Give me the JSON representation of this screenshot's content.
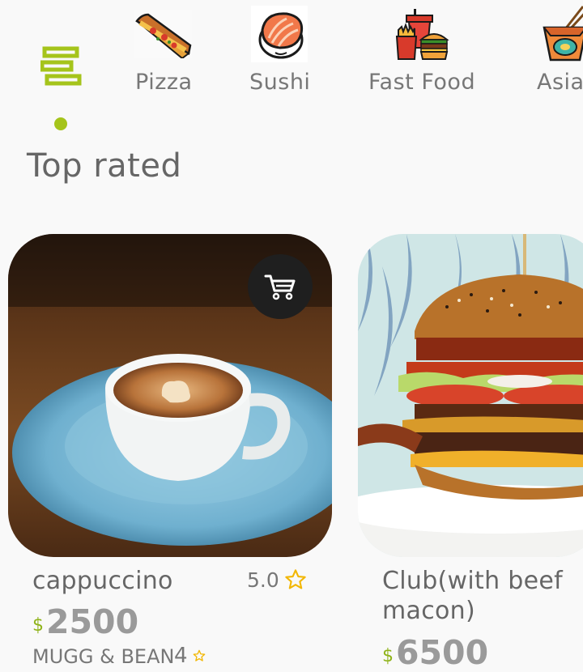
{
  "categories": [
    {
      "label": "Pizza",
      "icon": "pizza-icon"
    },
    {
      "label": "Sushi",
      "icon": "sushi-icon"
    },
    {
      "label": "Fast Food",
      "icon": "fast-food-icon"
    },
    {
      "label": "Asia",
      "icon": "asian-food-icon"
    }
  ],
  "colors": {
    "accent": "#a5c41b",
    "cart_button": "#1f1f1f",
    "star": "#f2b705"
  },
  "section_title": "Top rated",
  "products": [
    {
      "name": "cappuccino",
      "rating": "5.0",
      "currency": "$",
      "price": "2500",
      "store": "MUGG & BEAN",
      "store_rating": "4",
      "image": "coffee-cup-photo"
    },
    {
      "name_line1": "Club(with beef",
      "name_line2": "macon)",
      "currency": "$",
      "price": "6500",
      "image": "burger-photo"
    }
  ]
}
